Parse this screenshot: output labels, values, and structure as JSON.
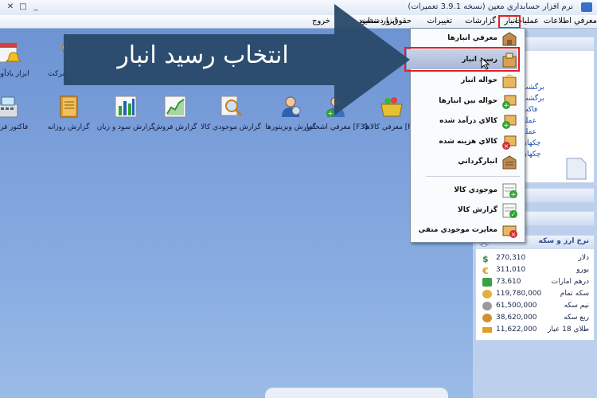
{
  "window": {
    "title": "نرم افزار حسابداري معين (نسخه 3.9.1 تعميرات)",
    "controls": [
      "minimize-icon",
      "maximize-icon",
      "close-icon"
    ]
  },
  "menu": {
    "items": [
      "معرفي اطلاعات",
      "عمليات",
      "گزارشات",
      "انبار",
      "تغییرات",
      "حقوق و دستمزد",
      "ابزار",
      "تنظیم",
      "خروج"
    ],
    "active": "انبار"
  },
  "dropdown": {
    "items": [
      {
        "label": "معرفي انبارها",
        "icon": "warehouse-box-icon"
      },
      {
        "label": "رسید انبار",
        "icon": "receipt-box-icon",
        "selected": true
      },
      {
        "label": "حواله انبار",
        "icon": "invoice-box-icon"
      },
      {
        "label": "حواله بين انبارها",
        "icon": "transfer-plus-icon"
      },
      {
        "label": "کالاي درآمد شده",
        "icon": "income-plus-icon"
      },
      {
        "label": "کالاي هزينه شده",
        "icon": "expense-x-icon"
      },
      {
        "label": "انبارگرداني",
        "icon": "stocktake-icon"
      },
      {
        "label": "موجودي کالا",
        "icon": "stock-sheet-plus-icon"
      },
      {
        "label": "گزارش کالا",
        "icon": "report-sheet-check-icon"
      },
      {
        "label": "مغايرت موجودي منفي",
        "icon": "negative-stock-icon"
      }
    ]
  },
  "annotation": {
    "text": "انتخاب رسید انبار"
  },
  "desktop": {
    "top_row": [
      {
        "label": "ابزار یادآوری",
        "icon": "calendar-bell-icon"
      },
      {
        "label": "شرکت",
        "icon": "company-icon"
      },
      {
        "label": "عرفي و ...",
        "icon": "person-icon"
      }
    ],
    "icons": [
      {
        "label": "فاکتور فروش",
        "icon": "cash-register-icon"
      },
      {
        "label": "گزارش روزانه",
        "icon": "notebook-icon"
      },
      {
        "label": "گزارش سود و زيان",
        "icon": "bar-chart-icon"
      },
      {
        "label": "گزارش فروش",
        "icon": "line-chart-icon"
      },
      {
        "label": "گزارش موجودي کالا",
        "icon": "magnifier-report-icon"
      },
      {
        "label": "گزارش ويزيتورها",
        "icon": "visitor-icon"
      },
      {
        "label": "معرفي اشخاص [F3]",
        "icon": "people-add-icon"
      },
      {
        "label": "معرفي کالاها [F2]",
        "icon": "basket-icon"
      }
    ]
  },
  "right_panel": {
    "links": [
      "برگشت",
      "برگشت",
      "فاکت",
      "عمليا",
      "عمليا",
      "چکهاي",
      "چکهاي"
    ],
    "currency_title": "نرخ ارز و سکه",
    "currencies": [
      {
        "name": "دلار",
        "value": "270,310",
        "icon": "dollar-icon",
        "color": "#2e8b2e"
      },
      {
        "name": "يورو",
        "value": "311,010",
        "icon": "euro-icon",
        "color": "#d8a020"
      },
      {
        "name": "درهم امارات",
        "value": "73,610",
        "icon": "dirham-icon",
        "color": "#3aa045"
      },
      {
        "name": "سکه تمام",
        "value": "119,780,000",
        "icon": "coin-gold-icon",
        "color": "#e0b040"
      },
      {
        "name": "نيم سکه",
        "value": "61,500,000",
        "icon": "coin-silver-icon",
        "color": "#9a9a9a"
      },
      {
        "name": "ربع سکه",
        "value": "38,620,000",
        "icon": "coin-bronze-icon",
        "color": "#d09030"
      },
      {
        "name": "طلاي 18 عيار",
        "value": "11,622,000",
        "icon": "gold-bar-icon",
        "color": "#e0a020"
      }
    ]
  },
  "colors": {
    "desktop": "#7a9ed8",
    "arrow": "#2a4a6a",
    "highlight": "#e02020",
    "selected": "#b3c1dd"
  }
}
